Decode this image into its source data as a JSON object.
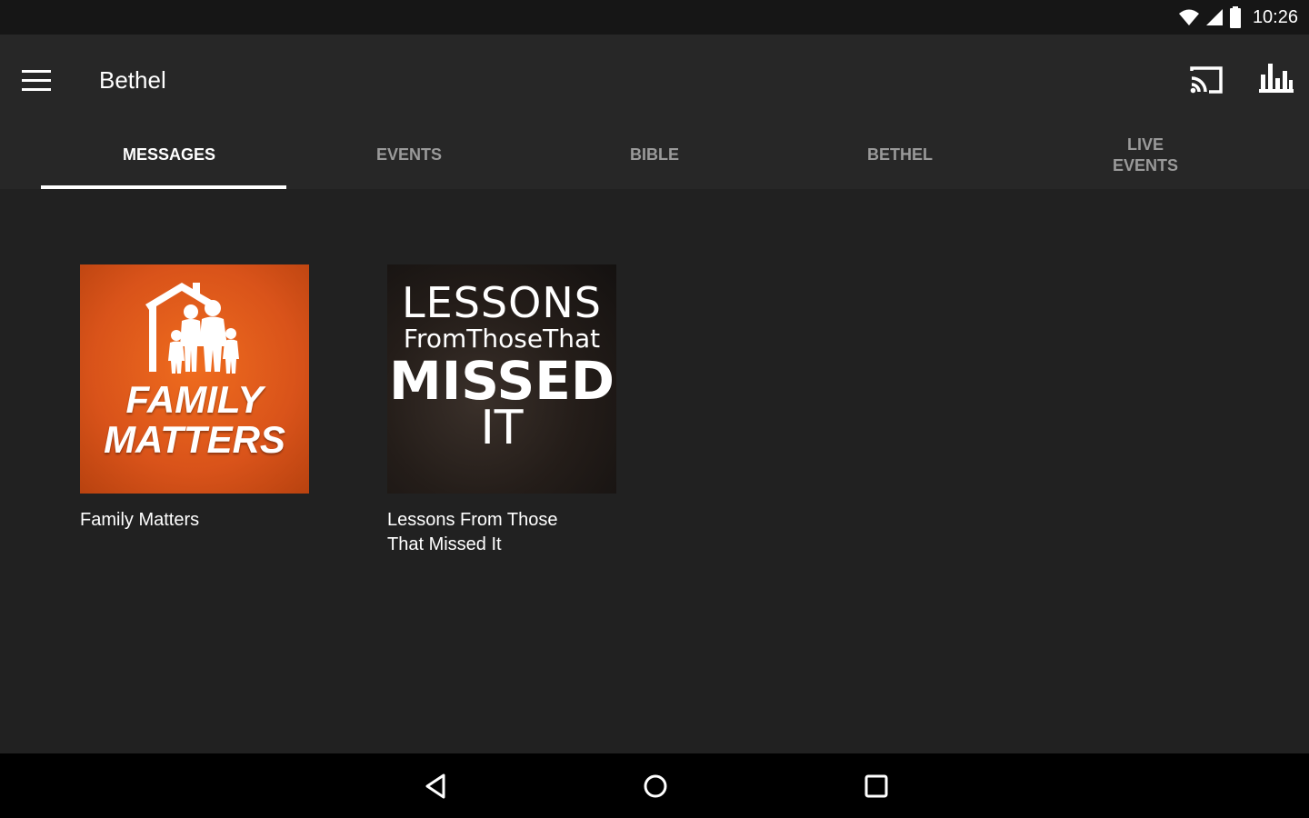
{
  "status_bar": {
    "time": "10:26",
    "icons": [
      "wifi-icon",
      "cell-signal-icon",
      "battery-icon"
    ]
  },
  "app_bar": {
    "title": "Bethel",
    "actions": [
      "cast-icon",
      "stats-icon"
    ]
  },
  "tabs": [
    {
      "label": "MESSAGES",
      "active": true
    },
    {
      "label": "EVENTS",
      "active": false
    },
    {
      "label": "BIBLE",
      "active": false
    },
    {
      "label": "BETHEL",
      "active": false
    },
    {
      "label": "LIVE EVENTS",
      "active": false
    }
  ],
  "series": [
    {
      "title": "Family Matters",
      "art_text": [
        "FAMILY",
        "MATTERS"
      ],
      "art_color": "#e05d1c"
    },
    {
      "title": "Lessons From Those That Missed It",
      "art_text": [
        "LESSONS",
        "FromThoseThat",
        "MISSED",
        "IT"
      ],
      "art_color": "#1e1915"
    }
  ],
  "nav_bar": {
    "buttons": [
      "back-icon",
      "home-icon",
      "recent-apps-icon"
    ]
  },
  "colors": {
    "status_bar": "#161616",
    "app_bar": "#272727",
    "background": "#212121",
    "nav_bar": "#000000",
    "tab_inactive": "#9a9a9a",
    "tab_active": "#ffffff"
  }
}
